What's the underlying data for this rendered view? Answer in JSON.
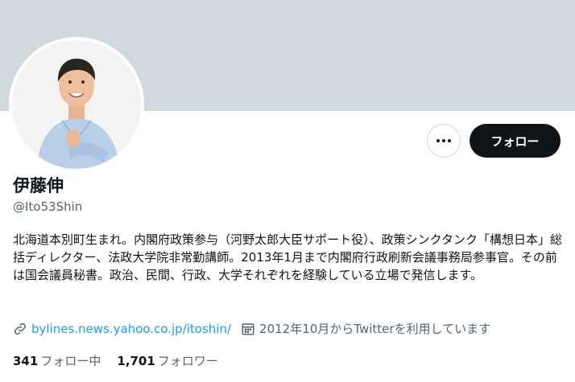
{
  "profile": {
    "display_name": "伊藤伸",
    "handle": "@Ito53Shin",
    "bio": "北海道本別町生まれ。内閣府政策参与（河野太郎大臣サポート役）、政策シンクタンク「構想日本」総括ディレクター、法政大学院非常勤講師。2013年1月まで内閣府行政刷新会議事務局参事官。その前は国会議員秘書。政治、民間、行政、大学それぞれを経験している立場で発信します。",
    "link": "bylines.news.yahoo.co.jp/itoshin/",
    "joined": "2012年10月からTwitterを利用しています"
  },
  "actions": {
    "follow_label": "フォロー",
    "more_icon": "more-dots-icon"
  },
  "stats": {
    "following_count": "341",
    "following_label": "フォロー中",
    "followers_count": "1,701",
    "followers_label": "フォロワー"
  },
  "colors": {
    "banner": "#cfd9de",
    "follow_button": "#0f1419",
    "link": "#1d9bf0",
    "secondary_text": "#536471"
  }
}
